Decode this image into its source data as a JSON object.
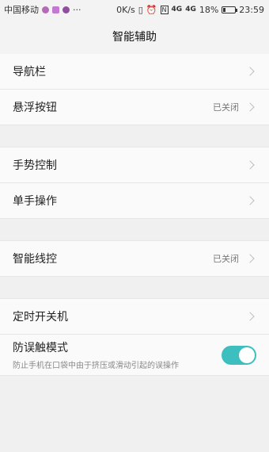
{
  "status_bar": {
    "carrier": "中国移动",
    "dots": "···",
    "speed": "0K/s",
    "network": "4G",
    "network2": "4G",
    "battery": "18%",
    "battery_level": 0.18,
    "time": "23:59"
  },
  "header": {
    "title": "智能辅助"
  },
  "sections": [
    {
      "items": [
        {
          "label": "导航栏",
          "value": ""
        },
        {
          "label": "悬浮按钮",
          "value": "已关闭"
        }
      ]
    },
    {
      "items": [
        {
          "label": "手势控制",
          "value": ""
        },
        {
          "label": "单手操作",
          "value": ""
        }
      ]
    },
    {
      "items": [
        {
          "label": "智能线控",
          "value": "已关闭"
        }
      ]
    },
    {
      "items": [
        {
          "label": "定时开关机",
          "value": ""
        },
        {
          "label": "防误触模式",
          "subtitle": "防止手机在口袋中由于挤压或滑动引起的误操作",
          "toggle": true
        }
      ]
    }
  ],
  "colors": {
    "accent": "#3dbfbf",
    "background": "#f1f1f1"
  }
}
